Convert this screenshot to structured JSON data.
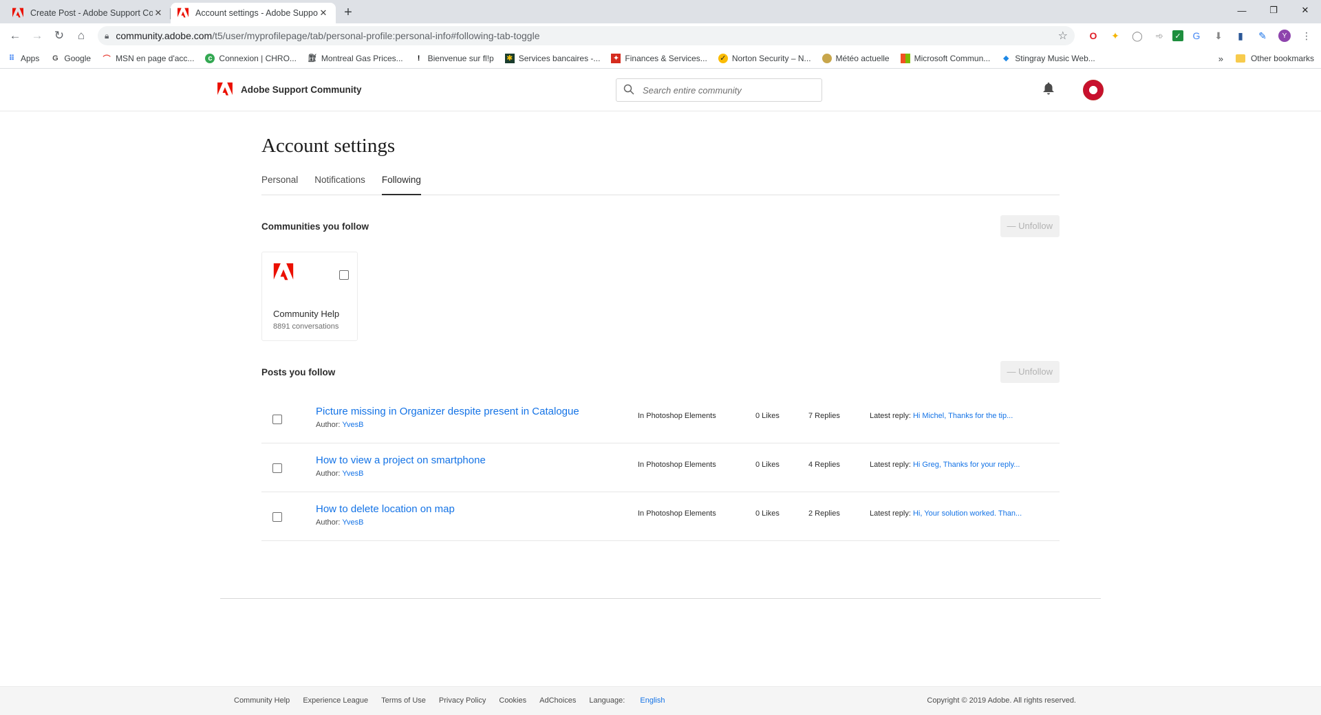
{
  "browser": {
    "tabs": [
      {
        "title": "Create Post - Adobe Support Com",
        "active": false
      },
      {
        "title": "Account settings - Adobe Suppo",
        "active": true
      }
    ],
    "url_host": "community.adobe.com",
    "url_path": "/t5/user/myprofilepage/tab/personal-profile:personal-info#following-tab-toggle",
    "profile_initial": "Y",
    "bookmarks": [
      {
        "label": "Apps",
        "icon": "apps-grid-icon"
      },
      {
        "label": "Google",
        "icon": "google-icon"
      },
      {
        "label": "MSN en page d'acc...",
        "icon": "msn-icon"
      },
      {
        "label": "Connexion | CHRO...",
        "icon": "chrono-icon"
      },
      {
        "label": "Montreal Gas Prices...",
        "icon": "gas-icon"
      },
      {
        "label": "Bienvenue sur fl!p",
        "icon": "flip-icon"
      },
      {
        "label": "Services bancaires -...",
        "icon": "bank-icon"
      },
      {
        "label": "Finances & Services...",
        "icon": "canada-flag-icon"
      },
      {
        "label": "Norton Security – N...",
        "icon": "norton-icon"
      },
      {
        "label": "Météo actuelle",
        "icon": "weather-icon"
      },
      {
        "label": "Microsoft Commun...",
        "icon": "microsoft-icon"
      },
      {
        "label": "Stingray Music Web...",
        "icon": "stingray-icon"
      }
    ],
    "other_bookmarks": "Other bookmarks"
  },
  "site": {
    "brand": "Adobe Support Community",
    "search_placeholder": "Search entire community"
  },
  "page": {
    "title": "Account settings",
    "tabs": [
      "Personal",
      "Notifications",
      "Following"
    ],
    "selected_tab": "Following",
    "communities_heading": "Communities you follow",
    "unfollow_label": "— Unfollow",
    "community": {
      "name": "Community Help",
      "count": "8891 conversations"
    },
    "posts_heading": "Posts you follow",
    "author_label": "Author:",
    "latest_label": "Latest reply:",
    "posts": [
      {
        "title": "Picture missing in Organizer despite present in Catalogue",
        "author": "YvesB",
        "board": "In Photoshop Elements",
        "likes": "0 Likes",
        "replies": "7 Replies",
        "latest": "Hi Michel, Thanks for the tip..."
      },
      {
        "title": "How to view a project on smartphone",
        "author": "YvesB",
        "board": "In Photoshop Elements",
        "likes": "0 Likes",
        "replies": "4 Replies",
        "latest": "Hi Greg, Thanks for your reply..."
      },
      {
        "title": "How to delete location on map",
        "author": "YvesB",
        "board": "In Photoshop Elements",
        "likes": "0 Likes",
        "replies": "2 Replies",
        "latest": "Hi, Your solution worked. Than..."
      }
    ]
  },
  "footer": {
    "links": [
      "Community Help",
      "Experience League",
      "Terms of Use",
      "Privacy Policy",
      "Cookies",
      "AdChoices"
    ],
    "language_label": "Language:",
    "language_value": "English",
    "copyright": "Copyright © 2019 Adobe. All rights reserved."
  },
  "colors": {
    "adobe_red": "#eb1000",
    "link_blue": "#1473e6"
  }
}
